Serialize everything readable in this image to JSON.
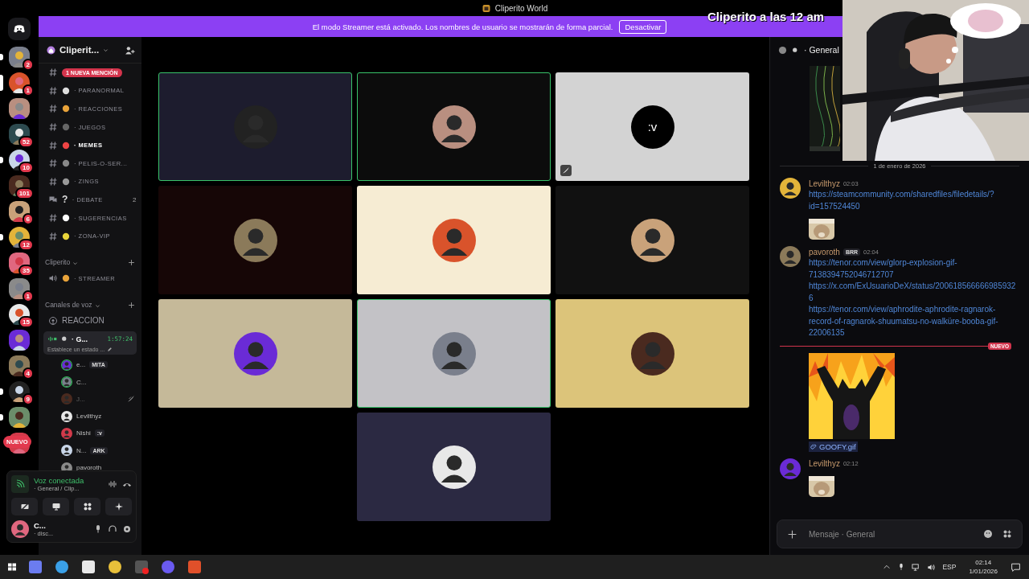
{
  "title_bar": {
    "title": "Cliperito World"
  },
  "banner": {
    "text": "El modo Streamer está activado. Los nombres de usuario se mostrarán de forma parcial.",
    "button": "Desactivar"
  },
  "stream_overlay": {
    "caption": "Cliperito a las 12 am"
  },
  "servers": [
    {
      "badge": "2",
      "selected": false,
      "unread": true
    },
    {
      "badge": "1",
      "selected": true,
      "unread": false
    },
    {
      "selected": false,
      "unread": false
    },
    {
      "badge": "52",
      "selected": false,
      "unread": false
    },
    {
      "badge": "10",
      "selected": false,
      "unread": true
    },
    {
      "badge": "101",
      "selected": false,
      "unread": false
    },
    {
      "badge": "6",
      "selected": false,
      "unread": false
    },
    {
      "badge": "12",
      "selected": false,
      "unread": true
    },
    {
      "badge": "35",
      "selected": false,
      "unread": false
    },
    {
      "badge": "1",
      "selected": false,
      "unread": false
    },
    {
      "badge": "15",
      "selected": false,
      "unread": false
    },
    {
      "selected": false,
      "unread": false
    },
    {
      "badge": "4",
      "selected": false,
      "unread": false
    },
    {
      "badge": "9",
      "selected": false,
      "unread": true
    },
    {
      "selected": false,
      "unread": true
    },
    {
      "label": "NUEVO",
      "selected": false,
      "unread": false
    }
  ],
  "server_header": {
    "name": "Cliperit..."
  },
  "mention_pill": "1 NUEVA MENCIÓN",
  "channels": [
    {
      "kind": "text",
      "name": "· PARANORMAL",
      "unread": false
    },
    {
      "kind": "text",
      "name": "· REACCIONES",
      "unread": false
    },
    {
      "kind": "text",
      "name": "· JUEGOS",
      "unread": false
    },
    {
      "kind": "text",
      "name": "· MEMES",
      "unread": true
    },
    {
      "kind": "text",
      "name": "· PELIS-O-SER...",
      "unread": false
    },
    {
      "kind": "text",
      "name": "· ZINGS",
      "unread": false
    },
    {
      "kind": "forum",
      "emoji": "?",
      "name": "· DEBATE",
      "count": "2",
      "unread": false
    },
    {
      "kind": "text",
      "name": "· SUGERENCIAS",
      "unread": false
    },
    {
      "kind": "text",
      "name": "· ZONA-VIP",
      "unread": false
    }
  ],
  "categories": [
    {
      "name": "Cliperito",
      "channels": [
        {
          "kind": "voice",
          "name": "· STREAMER"
        }
      ]
    },
    {
      "name": "Canales de voz",
      "channels": [
        {
          "kind": "stage",
          "name": "REACCION"
        }
      ]
    }
  ],
  "voice_channel": {
    "name": "· G...",
    "time": "1:57:24",
    "status": "Establece un estado ...",
    "selected": true,
    "users": [
      {
        "name": "e...",
        "tag": "MITA",
        "speaking": true,
        "muted": false
      },
      {
        "name": "C...",
        "speaking": true,
        "muted": false
      },
      {
        "name": "J...",
        "speaking": false,
        "muted": true
      },
      {
        "name": "Levilthyz",
        "speaking": false,
        "muted": false
      },
      {
        "name": "Nishi",
        "tag": ":v",
        "speaking": false,
        "muted": false
      },
      {
        "name": "N...",
        "tag": "ARK",
        "speaking": false,
        "muted": false
      },
      {
        "name": "pavoroth",
        "speaking": false,
        "muted": false
      }
    ]
  },
  "voice_panel": {
    "status": "Voz conectada",
    "location": "· General / Clip..."
  },
  "user_panel": {
    "name": "C...",
    "status": "· disc..."
  },
  "tiles": [
    {
      "color": "#1d1c2e",
      "speaking": true,
      "muted": false
    },
    {
      "color": "#0c0c0c",
      "speaking": true,
      "muted": false
    },
    {
      "color": "#d3d3d3",
      "speaking": false,
      "muted": true,
      "avatar_text": ":v"
    },
    {
      "color": "#160606",
      "speaking": false,
      "muted": false
    },
    {
      "color": "#f6ecd3",
      "speaking": false,
      "muted": false
    },
    {
      "color": "#111111",
      "speaking": false,
      "muted": false
    },
    {
      "color": "#c5b999",
      "speaking": false,
      "muted": false
    },
    {
      "color": "#c3c2c6",
      "speaking": true,
      "muted": false
    },
    {
      "color": "#dcc47a",
      "speaking": false,
      "muted": false
    },
    {
      "color": "#2b2942",
      "speaking": false,
      "muted": false
    }
  ],
  "chat": {
    "channel": "· General",
    "date": "1 de enero de 2026",
    "feed": [
      {
        "kind": "message",
        "author": "Levilthyz",
        "time": "02:03",
        "links": [
          "https://steamcommunity.com/sharedfiles/filedetails/?id=157524450"
        ],
        "image": true
      },
      {
        "kind": "message",
        "author": "pavoroth",
        "tag": "BRR",
        "time": "02:04",
        "links": [
          "https://tenor.com/view/glorp-explosion-gif-7138394752046712707",
          "https://x.com/ExUsuarioDeX/status/2006185666669859326",
          "https://tenor.com/view/aphrodite-aphrodite-ragnarok-record-of-ragnarok-shuumatsu-no-walküre-booba-gif-22006135"
        ]
      },
      {
        "kind": "divider",
        "label": "NUEVO"
      },
      {
        "kind": "gif",
        "filename": "GOOFY.gif"
      },
      {
        "kind": "message",
        "author": "Levilthyz",
        "time": "02:12",
        "image": true
      }
    ],
    "input": {
      "placeholder": "Mensaje · General"
    }
  },
  "taskbar": {
    "language": "ESP",
    "time": "02:14",
    "date": "1/01/2026"
  }
}
